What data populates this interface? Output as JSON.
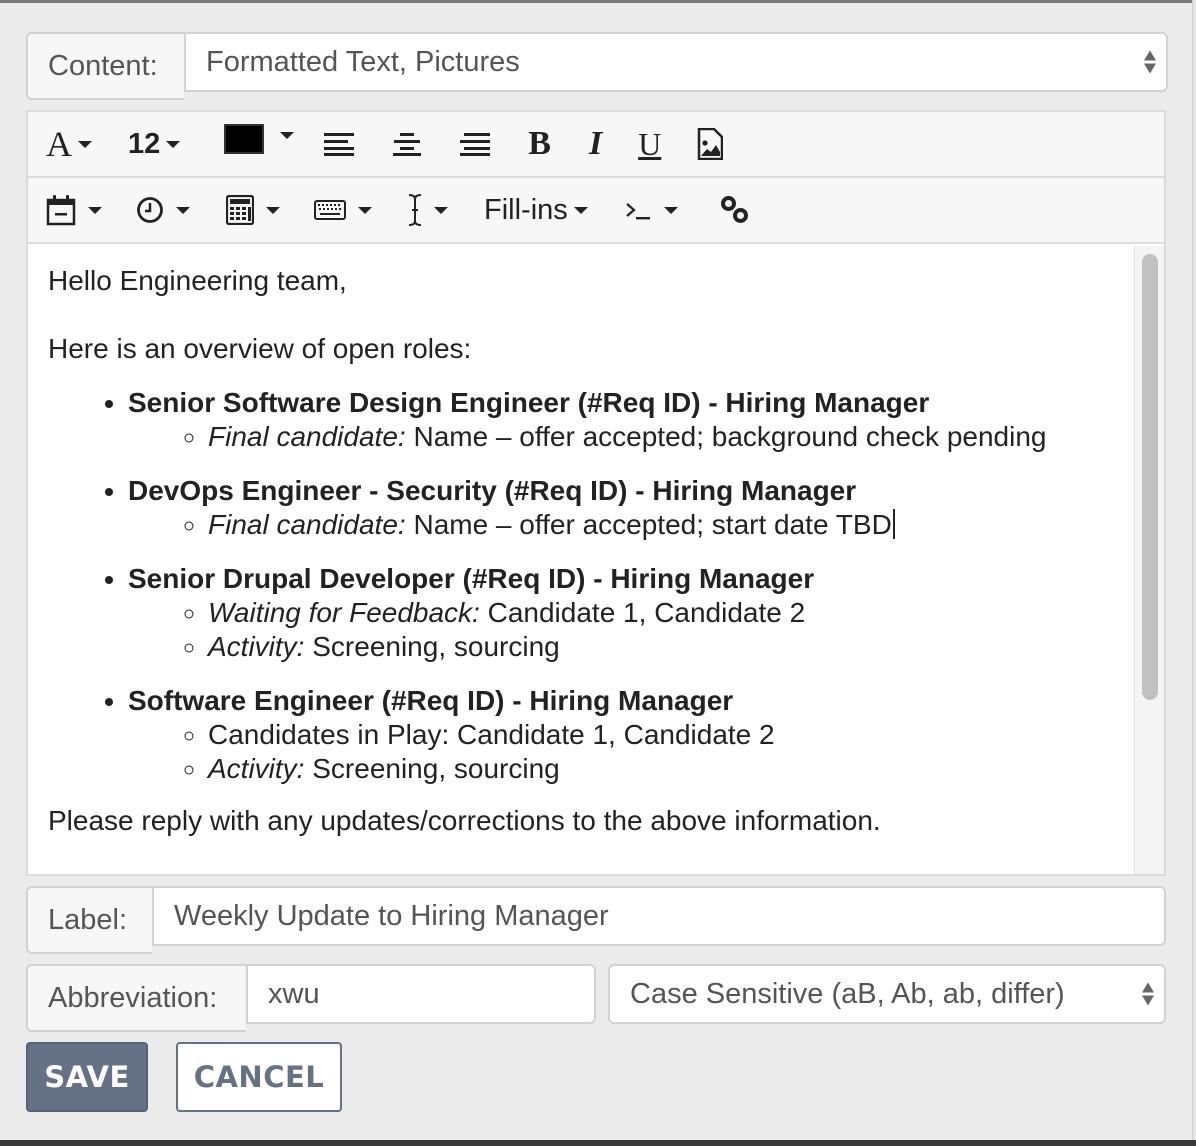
{
  "content_field": {
    "label": "Content:",
    "value": "Formatted Text, Pictures"
  },
  "toolbar": {
    "row1": {
      "font_family": {
        "icon": "font-icon",
        "glyph": "A"
      },
      "font_size": {
        "value": "12"
      },
      "text_color": {
        "color": "#000000"
      },
      "align_left": {
        "icon": "align-left-icon"
      },
      "align_center": {
        "icon": "align-center-icon"
      },
      "align_right": {
        "icon": "align-right-icon"
      },
      "bold": {
        "glyph": "B"
      },
      "italic": {
        "glyph": "I"
      },
      "underline": {
        "glyph": "U"
      },
      "insert_image": {
        "icon": "image-file-icon"
      }
    },
    "row2": {
      "date": {
        "icon": "calendar-icon"
      },
      "time": {
        "icon": "clock-icon"
      },
      "calculate": {
        "icon": "calculator-icon"
      },
      "key": {
        "icon": "keyboard-icon"
      },
      "cursor": {
        "icon": "text-cursor-icon"
      },
      "fillins": {
        "label": "Fill-ins"
      },
      "script": {
        "glyph": "›_"
      },
      "link": {
        "icon": "link-icon"
      }
    }
  },
  "editor": {
    "greeting": "Hello Engineering team,",
    "intro": "Here is an overview of open roles:",
    "roles": [
      {
        "title": "Senior Software Design Engineer (#Req ID) - Hiring Manager",
        "items": [
          {
            "label": "Final candidate:",
            "text": " Name – offer accepted; background check pending"
          }
        ]
      },
      {
        "title": "DevOps Engineer - Security (#Req ID) - Hiring Manager",
        "items": [
          {
            "label": "Final candidate:",
            "text": " Name – offer accepted; start date TBD"
          }
        ]
      },
      {
        "title": "Senior Drupal Developer (#Req ID) - Hiring Manager",
        "items": [
          {
            "label": "Waiting for Feedback:",
            "text": " Candidate 1, Candidate 2"
          },
          {
            "label": "Activity:",
            "text": " Screening, sourcing"
          }
        ]
      },
      {
        "title": "Software Engineer (#Req ID) - Hiring Manager",
        "items": [
          {
            "label": "",
            "text": "Candidates in Play: Candidate 1, Candidate 2"
          },
          {
            "label": "Activity:",
            "text": " Screening, sourcing"
          }
        ]
      }
    ],
    "closing": "Please reply with any updates/corrections to the above information."
  },
  "label_field": {
    "label": "Label:",
    "value": "Weekly Update to Hiring Manager"
  },
  "abbreviation_field": {
    "label": "Abbreviation:",
    "value": "xwu"
  },
  "case_select": {
    "value": "Case Sensitive (aB, Ab, ab, differ)"
  },
  "buttons": {
    "save": "SAVE",
    "cancel": "CANCEL"
  },
  "colors": {
    "primary_button": "#657286",
    "background": "#ebebeb"
  }
}
